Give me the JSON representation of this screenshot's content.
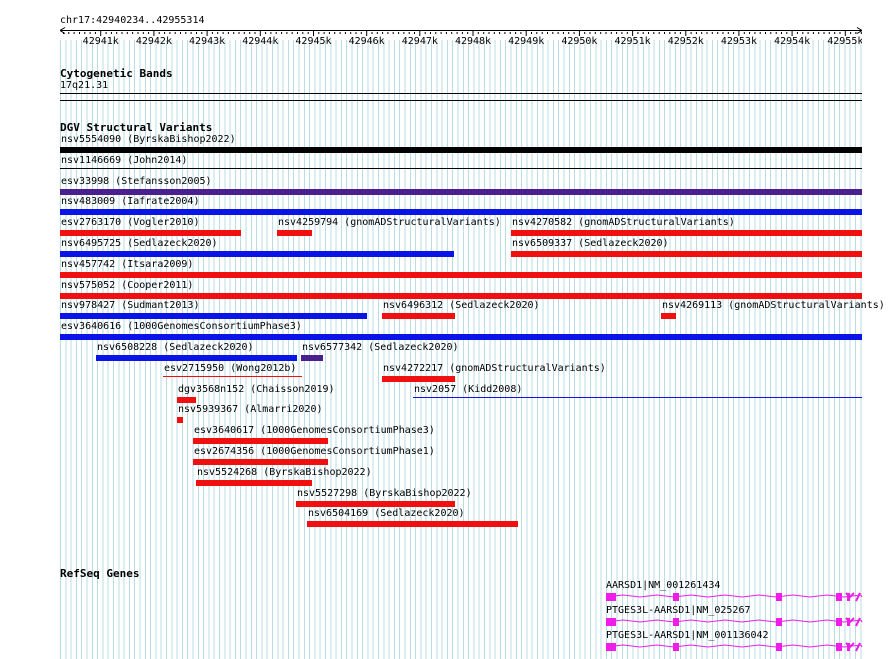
{
  "region": "chr17:42940234..42955314",
  "ruler": {
    "start": 42940234,
    "end": 42955314,
    "ticks": [
      "42941k",
      "42942k",
      "42943k",
      "42944k",
      "42945k",
      "42946k",
      "42947k",
      "42948k",
      "42949k",
      "42950k",
      "42951k",
      "42952k",
      "42953k",
      "42954k",
      "42955k"
    ]
  },
  "cytoband": {
    "title": "Cytogenetic Bands",
    "band": "17q21.31"
  },
  "dgv": {
    "title": "DGV Structural Variants",
    "features": [
      {
        "id": "nsv5554090 (ByrskaBishop2022)",
        "start": 42940234,
        "end": 42955314,
        "color": "#000000",
        "row": 0
      },
      {
        "id": "nsv1146669 (John2014)",
        "start": 42940234,
        "end": 42955314,
        "color": "#000000",
        "row": 1,
        "thin": true
      },
      {
        "id": "esv33998 (Stefansson2005)",
        "start": 42940234,
        "end": 42955314,
        "color": "#4b1f8f",
        "row": 2
      },
      {
        "id": "nsv483009 (Iafrate2004)",
        "start": 42940234,
        "end": 42955314,
        "color": "#0a14e6",
        "row": 3
      },
      {
        "id": "esv2763170 (Vogler2010)",
        "start": 42940234,
        "end": 42943630,
        "color": "#f01010",
        "row": 4
      },
      {
        "id": "nsv4259794 (gnomADStructuralVariants)",
        "start": 42944320,
        "end": 42944970,
        "color": "#f01010",
        "row": 4
      },
      {
        "id": "nsv4270582 (gnomADStructuralVariants)",
        "start": 42948720,
        "end": 42955314,
        "color": "#f01010",
        "row": 4
      },
      {
        "id": "nsv6495725 (Sedlazeck2020)",
        "start": 42940234,
        "end": 42947640,
        "color": "#0a14e6",
        "row": 5
      },
      {
        "id": "nsv6509337 (Sedlazeck2020)",
        "start": 42948720,
        "end": 42955314,
        "color": "#f01010",
        "row": 5
      },
      {
        "id": "nsv457742 (Itsara2009)",
        "start": 42940234,
        "end": 42955314,
        "color": "#f01010",
        "row": 6
      },
      {
        "id": "nsv575052 (Cooper2011)",
        "start": 42940234,
        "end": 42955314,
        "color": "#f01010",
        "row": 7
      },
      {
        "id": "nsv978427 (Sudmant2013)",
        "start": 42940234,
        "end": 42946000,
        "color": "#0a14e6",
        "row": 8
      },
      {
        "id": "nsv6496312 (Sedlazeck2020)",
        "start": 42946290,
        "end": 42947660,
        "color": "#f01010",
        "row": 8
      },
      {
        "id": "nsv4269113 (gnomADStructuralVariants)",
        "start": 42951540,
        "end": 42951830,
        "color": "#f01010",
        "row": 8
      },
      {
        "id": "esv3640616 (1000GenomesConsortiumPhase3)",
        "start": 42940234,
        "end": 42955314,
        "color": "#0a14e6",
        "row": 9
      },
      {
        "id": "nsv6508228 (Sedlazeck2020)",
        "start": 42940910,
        "end": 42944690,
        "color": "#0a14e6",
        "row": 10
      },
      {
        "id": "nsv6577342 (Sedlazeck2020)",
        "start": 42944770,
        "end": 42945190,
        "color": "#4b1f8f",
        "row": 10
      },
      {
        "id": "esv2715950 (Wong2012b)",
        "start": 42942170,
        "end": 42944780,
        "color": "#f01010",
        "row": 11,
        "thin": true
      },
      {
        "id": "nsv4272217 (gnomADStructuralVariants)",
        "start": 42946290,
        "end": 42947660,
        "color": "#f01010",
        "row": 11
      },
      {
        "id": "dgv3568n152 (Chaisson2019)",
        "start": 42942430,
        "end": 42942780,
        "color": "#f01010",
        "row": 12
      },
      {
        "id": "nsv2057 (Kidd2008)",
        "start": 42946880,
        "end": 42955314,
        "color": "#0a14e6",
        "row": 12,
        "thin": true
      },
      {
        "id": "nsv5939367 (Almarri2020)",
        "start": 42942430,
        "end": 42942540,
        "color": "#f01010",
        "row": 13
      },
      {
        "id": "esv3640617 (1000GenomesConsortiumPhase3)",
        "start": 42942740,
        "end": 42945270,
        "color": "#f01010",
        "row": 14
      },
      {
        "id": "esv2674356 (1000GenomesConsortiumPhase1)",
        "start": 42942740,
        "end": 42945270,
        "color": "#f01010",
        "row": 15
      },
      {
        "id": "nsv5524268 (ByrskaBishop2022)",
        "start": 42942800,
        "end": 42944990,
        "color": "#f01010",
        "row": 16
      },
      {
        "id": "nsv5527298 (ByrskaBishop2022)",
        "start": 42944680,
        "end": 42947670,
        "color": "#f01010",
        "row": 17
      },
      {
        "id": "nsv6504169 (Sedlazeck2020)",
        "start": 42944880,
        "end": 42948840,
        "color": "#f01010",
        "row": 18
      }
    ]
  },
  "refseq": {
    "title": "RefSeq Genes",
    "color": "#ee1ee8",
    "genes": [
      {
        "name": "AARSD1|NM_001261434"
      },
      {
        "name": "PTGES3L-AARSD1|NM_025267"
      },
      {
        "name": "PTGES3L-AARSD1|NM_001136042"
      }
    ]
  }
}
